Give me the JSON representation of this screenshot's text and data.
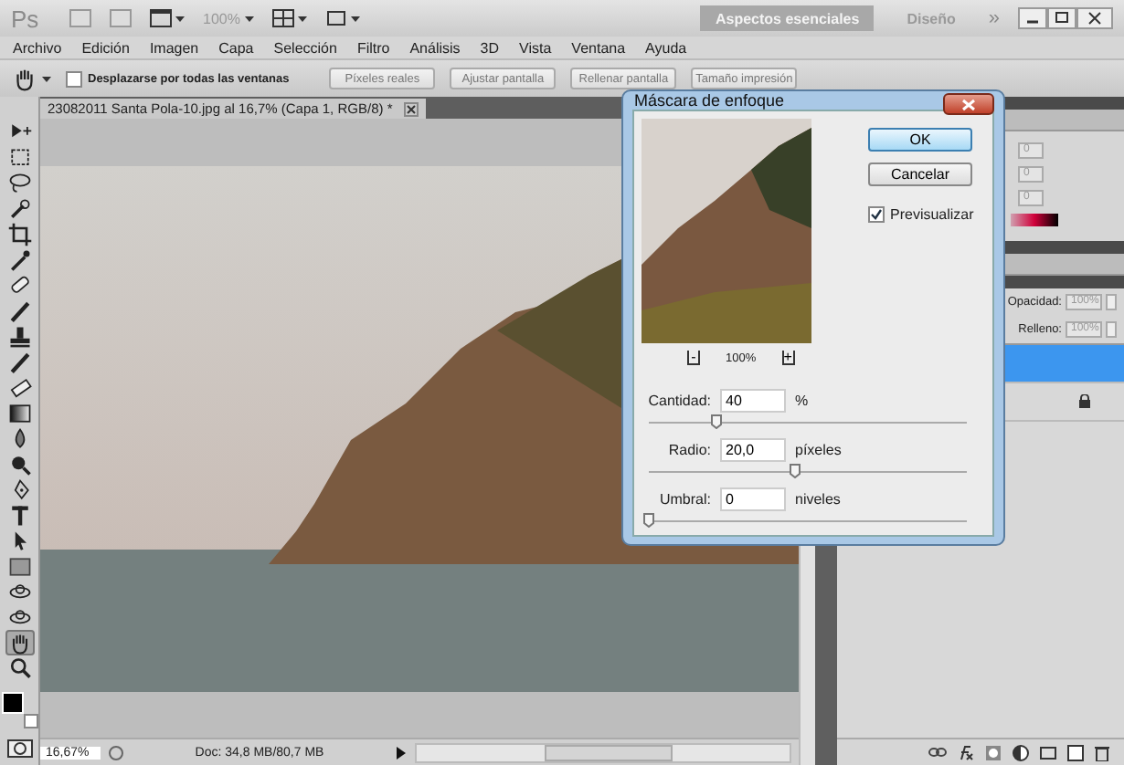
{
  "app_bar": {
    "logo": "Ps",
    "zoom": "100%",
    "workspaces": [
      {
        "label": "Aspectos esenciales",
        "selected": true
      },
      {
        "label": "Diseño",
        "selected": false
      }
    ],
    "more": "»"
  },
  "menu": [
    "Archivo",
    "Edición",
    "Imagen",
    "Capa",
    "Selección",
    "Filtro",
    "Análisis",
    "3D",
    "Vista",
    "Ventana",
    "Ayuda"
  ],
  "options_bar": {
    "scroll_all": {
      "label": "Desplazarse por todas las ventanas",
      "checked": false
    },
    "buttons": [
      "Píxeles reales",
      "Ajustar pantalla",
      "Rellenar pantalla",
      "Tamaño impresión"
    ]
  },
  "document": {
    "tab": "23082011 Santa Pola-10.jpg al 16,7% (Capa 1, RGB/8) *",
    "zoom": "16,67%",
    "info": "Doc: 34,8 MB/80,7 MB"
  },
  "tools": [
    {
      "kind": "move",
      "selected": false
    },
    {
      "kind": "marquee",
      "selected": false
    },
    {
      "kind": "lasso",
      "selected": false
    },
    {
      "kind": "wand",
      "selected": false
    },
    {
      "kind": "crop",
      "selected": false
    },
    {
      "kind": "eyedropper",
      "selected": false
    },
    {
      "kind": "bandage",
      "selected": false
    },
    {
      "kind": "brush",
      "selected": false
    },
    {
      "kind": "stamp",
      "selected": false
    },
    {
      "kind": "brush",
      "selected": false
    },
    {
      "kind": "eraser",
      "selected": false
    },
    {
      "kind": "gradient",
      "selected": false
    },
    {
      "kind": "drop",
      "selected": false
    },
    {
      "kind": "dodge",
      "selected": false
    },
    {
      "kind": "pen",
      "selected": false
    },
    {
      "kind": "type",
      "selected": false
    },
    {
      "kind": "arrow",
      "selected": false
    },
    {
      "kind": "rect",
      "selected": false
    },
    {
      "kind": "orbit",
      "selected": false
    },
    {
      "kind": "orbit",
      "selected": false
    },
    {
      "kind": "hand",
      "selected": true
    },
    {
      "kind": "zoom",
      "selected": false
    }
  ],
  "dialog": {
    "title": "Máscara de enfoque",
    "zoom_out": "-",
    "zoom": "100%",
    "zoom_in": "+",
    "buttons": [
      {
        "label": "OK",
        "selected": true
      },
      {
        "label": "Cancelar",
        "selected": false
      }
    ],
    "preview": {
      "label": "Previsualizar",
      "checked": true
    },
    "fields": [
      {
        "label": "Cantidad:",
        "value": "40",
        "unit": "%",
        "level": 0.21
      },
      {
        "label": "Radio:",
        "value": "20,0",
        "unit": "píxeles",
        "level": 0.46
      },
      {
        "label": "Umbral:",
        "value": "0",
        "unit": "niveles",
        "level": 0
      }
    ]
  },
  "panels": {
    "color_values": [
      "0",
      "0",
      "0"
    ],
    "opacity_label": "Opacidad:",
    "opacity": "100%",
    "fill_label": "Relleno:",
    "fill": "100%",
    "layers": [
      {
        "selected": true,
        "locked": false
      },
      {
        "selected": false,
        "locked": true
      }
    ]
  }
}
